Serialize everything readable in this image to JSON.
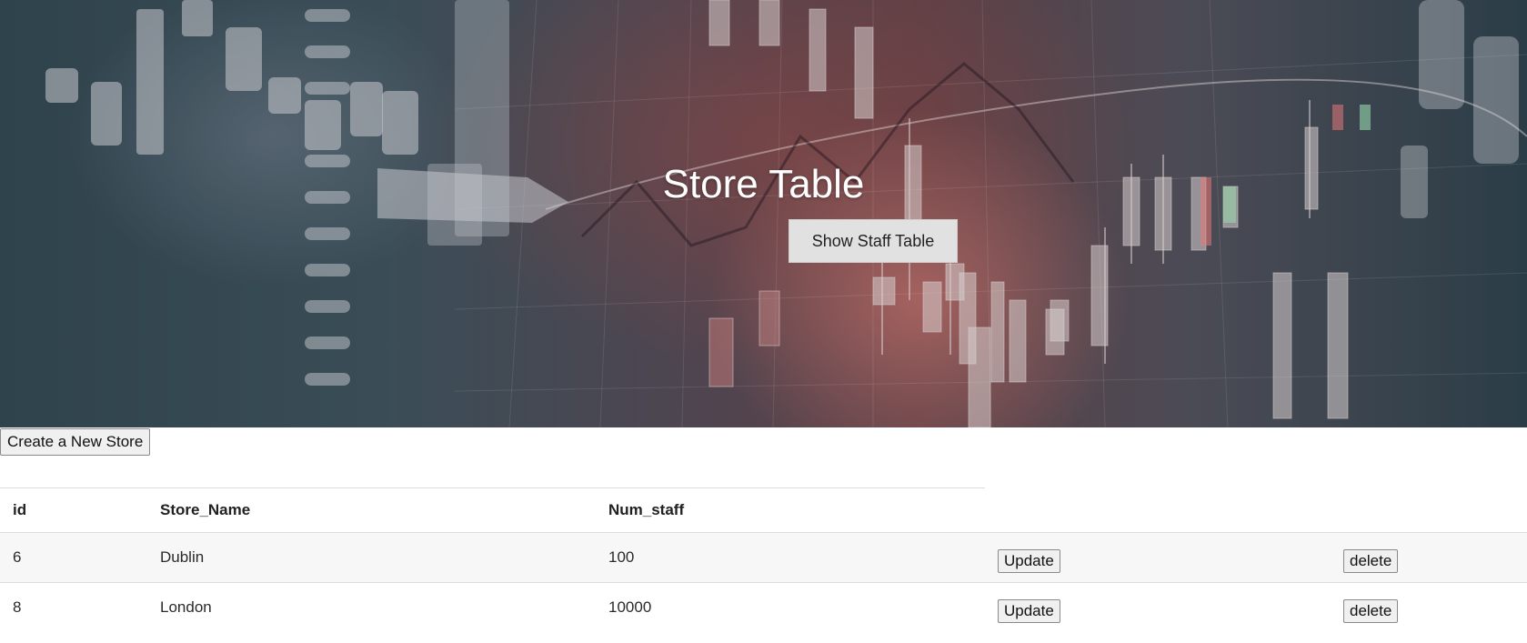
{
  "hero": {
    "title": "Store Table",
    "staff_button_label": "Show Staff Table"
  },
  "toolbar": {
    "create_label": "Create a New Store"
  },
  "table": {
    "columns": [
      "id",
      "Store_Name",
      "Num_staff"
    ],
    "rows": [
      {
        "id": "6",
        "store_name": "Dublin",
        "num_staff": "100",
        "update_label": "Update",
        "delete_label": "delete"
      },
      {
        "id": "8",
        "store_name": "London",
        "num_staff": "10000",
        "update_label": "Update",
        "delete_label": "delete"
      }
    ]
  },
  "colors": {
    "table_stripe": "#f7f7f7",
    "button_bg": "#f0f0f0",
    "hero_button_bg": "#e1e1e1"
  }
}
